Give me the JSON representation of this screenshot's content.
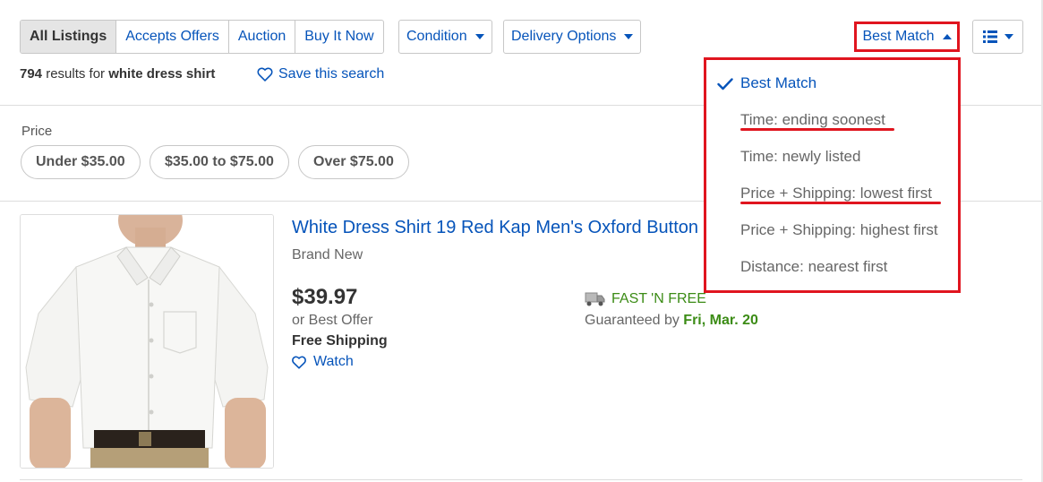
{
  "toolbar": {
    "listing_tabs": [
      "All Listings",
      "Accepts Offers",
      "Auction",
      "Buy It Now"
    ],
    "condition_label": "Condition",
    "delivery_label": "Delivery Options",
    "sort_label": "Best Match"
  },
  "results": {
    "count": "794",
    "text": " results for ",
    "query": "white dress shirt",
    "save_label": "Save this search"
  },
  "price_filter": {
    "label": "Price",
    "options": [
      "Under $35.00",
      "$35.00 to $75.00",
      "Over $75.00"
    ]
  },
  "listing": {
    "title": "White Dress Shirt 19 Red Kap Men's Oxford Button",
    "condition": "Brand New",
    "price": "$39.97",
    "offer": "or Best Offer",
    "shipping": "Free Shipping",
    "watch_label": "Watch",
    "fast_free": "FAST 'N FREE",
    "guaranteed_prefix": "Guaranteed by ",
    "guaranteed_date": "Fri, Mar. 20"
  },
  "sort_menu": {
    "items": [
      "Best Match",
      "Time: ending soonest",
      "Time: newly listed",
      "Price + Shipping: lowest first",
      "Price + Shipping: highest first",
      "Distance: nearest first"
    ],
    "selected": "Best Match"
  },
  "colors": {
    "link": "#0654ba",
    "highlight": "#e0151f",
    "fast_free_green": "#3c8c16"
  },
  "icons": [
    "checkmark-icon",
    "caret-down-icon",
    "caret-up-icon",
    "list-view-icon",
    "heart-icon",
    "truck-icon"
  ]
}
